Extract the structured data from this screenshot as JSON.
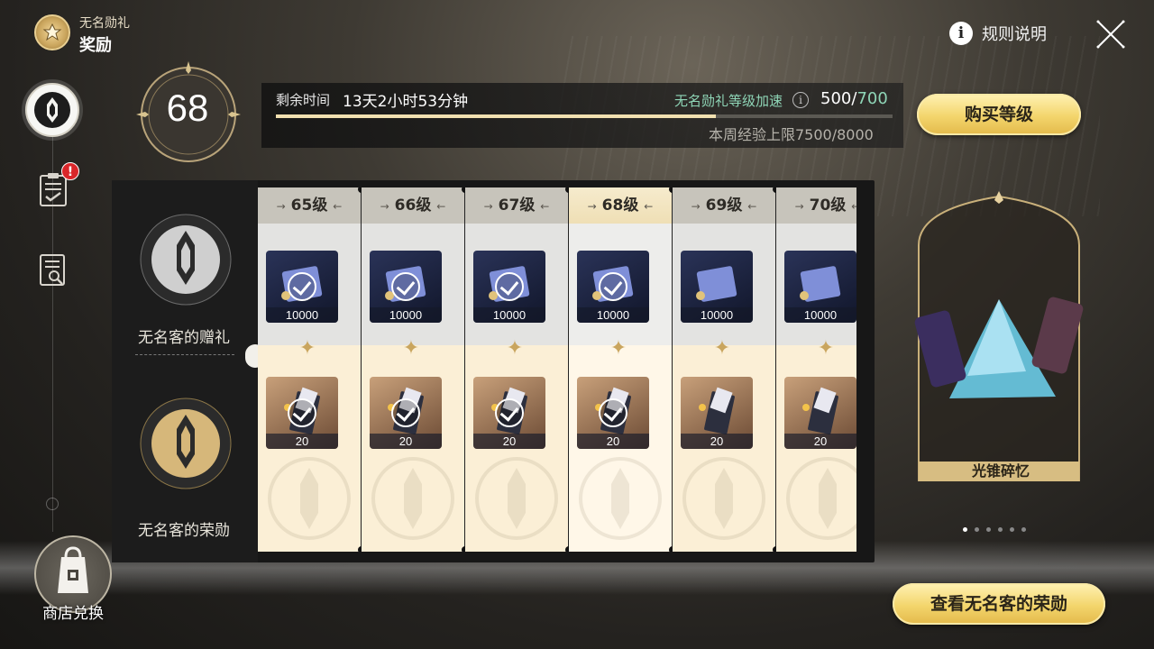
{
  "title": {
    "subtitle": "无名勋礼",
    "main": "奖励"
  },
  "topbar": {
    "rules_label": "规则说明",
    "rules_icon": "info-icon",
    "close_icon": "close-icon"
  },
  "nav": {
    "items": [
      {
        "icon": "nameless-emblem-icon",
        "active": true
      },
      {
        "icon": "clipboard-check-icon",
        "badge": "!"
      },
      {
        "icon": "document-search-icon"
      }
    ],
    "shop_label": "商店兑换",
    "shop_icon": "shopping-bag-icon"
  },
  "level": {
    "current": "68",
    "remaining_label": "剩余时间",
    "remaining_value": "13天2小时53分钟",
    "boost_label": "无名勋礼等级加速",
    "exp_current": "500",
    "exp_separator": "/",
    "exp_max": "700",
    "exp_progress": 0.714,
    "weekly_limit": "本周经验上限7500/8000",
    "buy_button": "购买等级"
  },
  "tracks": {
    "free_label": "无名客的赠礼",
    "premium_label": "无名客的荣勋"
  },
  "levels": [
    {
      "label": "65级",
      "free_amount": "10000",
      "premium_amount": "20",
      "claimed": true,
      "current": false
    },
    {
      "label": "66级",
      "free_amount": "10000",
      "premium_amount": "20",
      "claimed": true,
      "current": false
    },
    {
      "label": "67级",
      "free_amount": "10000",
      "premium_amount": "20",
      "claimed": true,
      "current": false
    },
    {
      "label": "68级",
      "free_amount": "10000",
      "premium_amount": "20",
      "claimed": true,
      "current": true
    },
    {
      "label": "69级",
      "free_amount": "10000",
      "premium_amount": "20",
      "claimed": false,
      "current": false
    },
    {
      "label": "70级",
      "free_amount": "10000",
      "premium_amount": "20",
      "claimed": false,
      "current": false
    }
  ],
  "showcase": {
    "label": "光锥碎忆",
    "pages": 6,
    "active_page": 0
  },
  "honor_button": "查看无名客的荣勋",
  "colors": {
    "accent_gold": "#f3d56c",
    "boost_green": "#8fd6b7",
    "alert_red": "#d9262a"
  }
}
